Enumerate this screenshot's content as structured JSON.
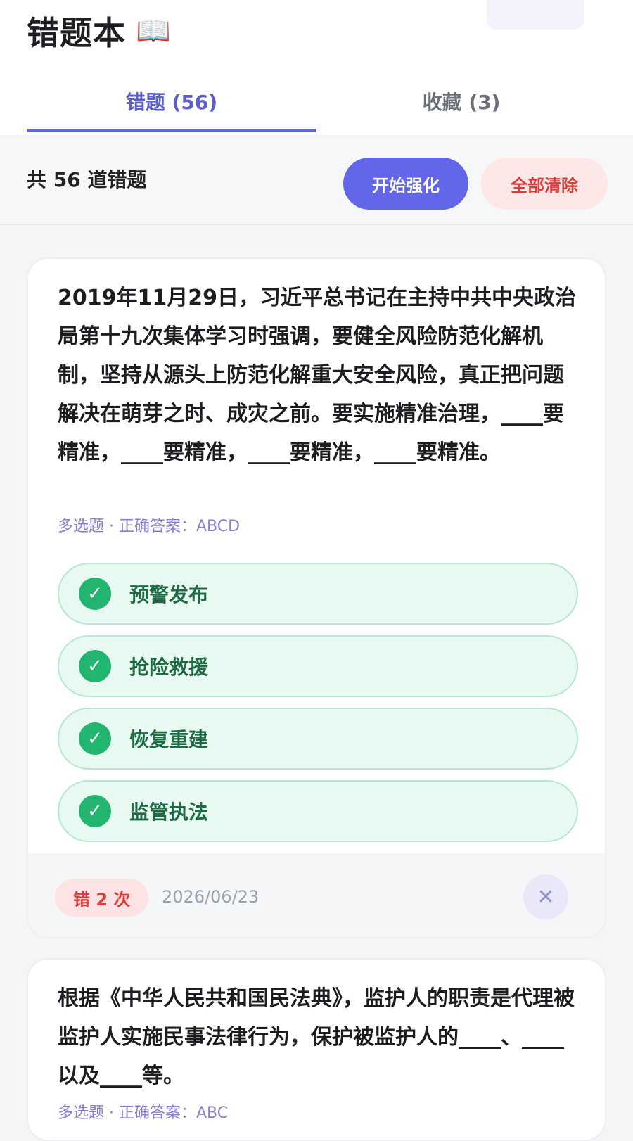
{
  "header": {
    "title": "错题本",
    "title_icon": "📖",
    "tabs": [
      {
        "label": "错题 (56)",
        "active": true
      },
      {
        "label": "收藏 (3)",
        "active": false
      }
    ]
  },
  "toolbar": {
    "count_text": "共 56 道错题",
    "start_label": "开始强化",
    "clear_label": "全部清除"
  },
  "questions": [
    {
      "text": "2019年11月29日，习近平总书记在主持中共中央政治局第十九次集体学习时强调，要健全风险防范化解机制，坚持从源头上防范化解重大安全风险，真正把问题解决在萌芽之时、成灾之前。要实施精准治理，____要精准，____要精准，____要精准，____要精准。",
      "meta": "多选题 · 正确答案：ABCD",
      "options": [
        "预警发布",
        "抢险救援",
        "恢复重建",
        "监管执法"
      ],
      "wrong_count": "错 2 次",
      "date": "2026/06/23"
    },
    {
      "text": "根据《中华人民共和国民法典》，监护人的职责是代理被监护人实施民事法律行为，保护被监护人的____、____以及____等。",
      "meta": "多选题 · 正确答案：ABC"
    }
  ],
  "colors": {
    "accent": "#6366e8",
    "danger": "#e03a3a",
    "correct": "#22b56f"
  }
}
